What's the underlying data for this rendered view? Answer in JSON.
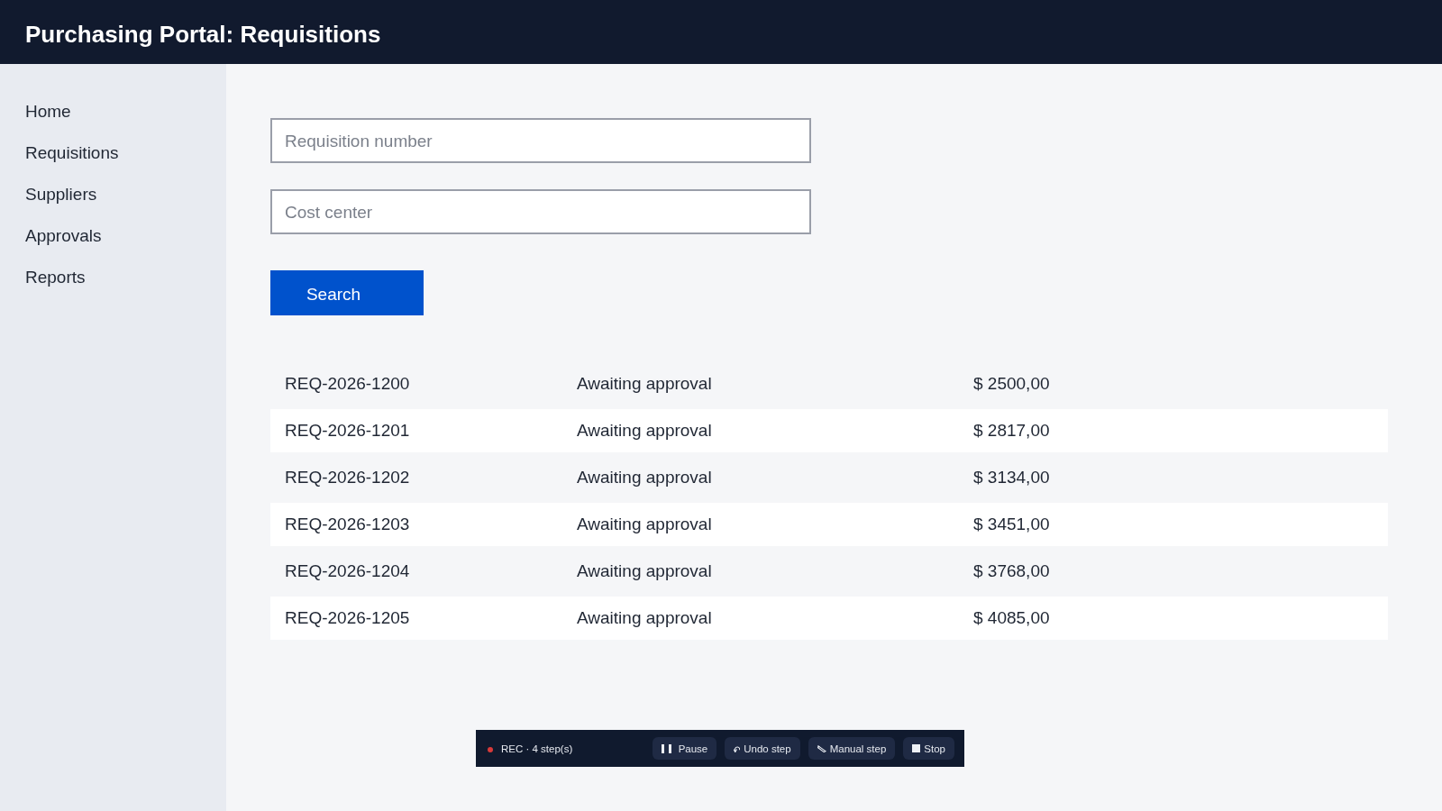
{
  "header": {
    "title": "Purchasing Portal: Requisitions"
  },
  "sidebar": {
    "items": [
      {
        "label": "Home",
        "selected": false
      },
      {
        "label": "Requisitions",
        "selected": false
      },
      {
        "label": "Suppliers",
        "selected": false
      },
      {
        "label": "Approvals",
        "selected": false
      },
      {
        "label": "Reports",
        "selected": false
      }
    ]
  },
  "search_form": {
    "fields": [
      {
        "placeholder": "Requisition number"
      },
      {
        "placeholder": "Cost center"
      }
    ],
    "button": "Search"
  },
  "results": {
    "rows": [
      [
        "REQ-2026-1200",
        "Awaiting approval",
        "$ 2500,00"
      ],
      [
        "REQ-2026-1201",
        "Awaiting approval",
        "$ 2817,00"
      ],
      [
        "REQ-2026-1202",
        "Awaiting approval",
        "$ 3134,00"
      ],
      [
        "REQ-2026-1203",
        "Awaiting approval",
        "$ 3451,00"
      ],
      [
        "REQ-2026-1204",
        "Awaiting approval",
        "$ 3768,00"
      ],
      [
        "REQ-2026-1205",
        "Awaiting approval",
        "$ 4085,00"
      ]
    ]
  },
  "recorder_bar": {
    "status": "REC · 4 step(s)",
    "buttons": [
      {
        "label": "Pause",
        "kind": "pause"
      },
      {
        "label": "Undo step",
        "kind": "undo"
      },
      {
        "label": "Manual step",
        "kind": "manual"
      },
      {
        "label": "Stop",
        "kind": "stop"
      }
    ]
  }
}
